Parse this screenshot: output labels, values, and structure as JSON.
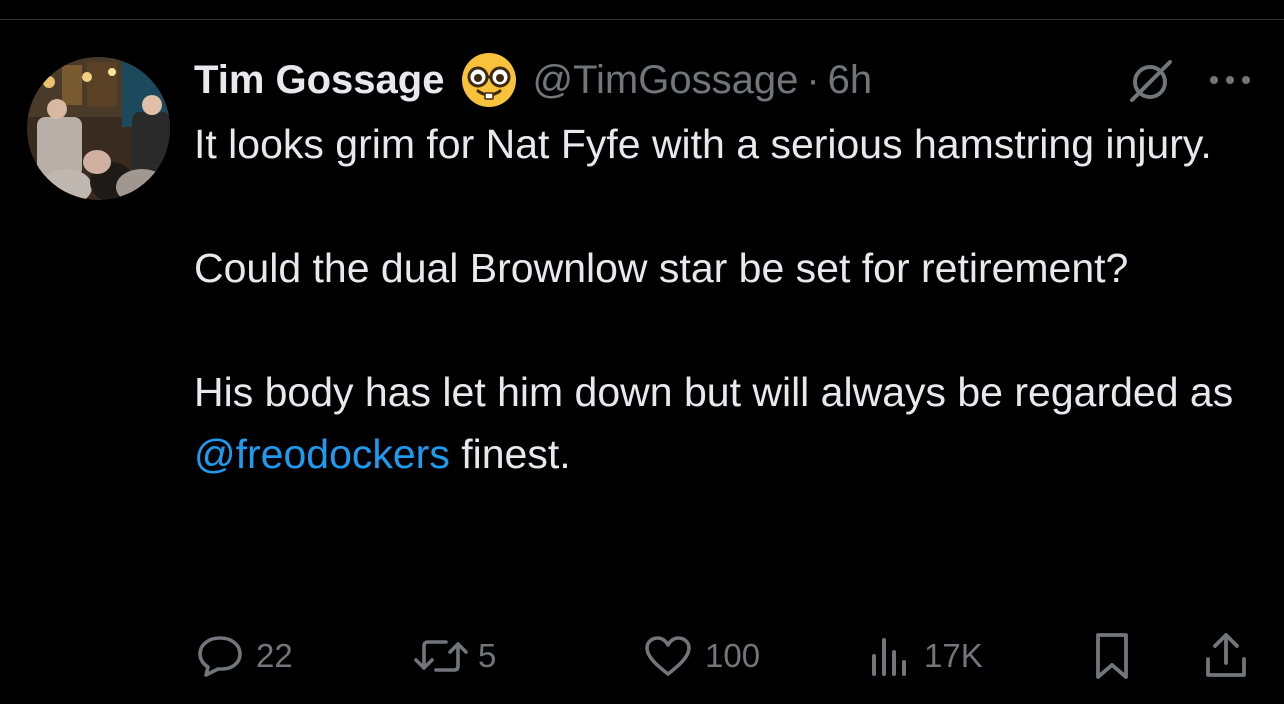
{
  "tweet": {
    "author_name": "Tim Gossage",
    "author_emoji": "nerd-face-emoji",
    "handle": "@TimGossage",
    "separator": "·",
    "time": "6h",
    "text": {
      "line1": "It looks grim for Nat Fyfe with a serious hamstring injury.",
      "line2": "Could the dual Brownlow star be set for retirement?",
      "line3_before": "His body has let him down but will always be regarded as ",
      "line3_mention": "@freodockers",
      "line3_after": " finest."
    }
  },
  "actions": {
    "replies": "22",
    "reposts": "5",
    "likes": "100",
    "views": "17K"
  },
  "icons": {
    "reply": "reply-icon",
    "repost": "repost-icon",
    "like": "heart-icon",
    "views": "views-chart-icon",
    "bookmark": "bookmark-icon",
    "share": "share-icon",
    "grok": "grok-icon",
    "more": "more-icon"
  },
  "colors": {
    "background": "#000000",
    "text": "#e7e9ea",
    "secondary": "#71767b",
    "link": "#1d9bf0"
  }
}
